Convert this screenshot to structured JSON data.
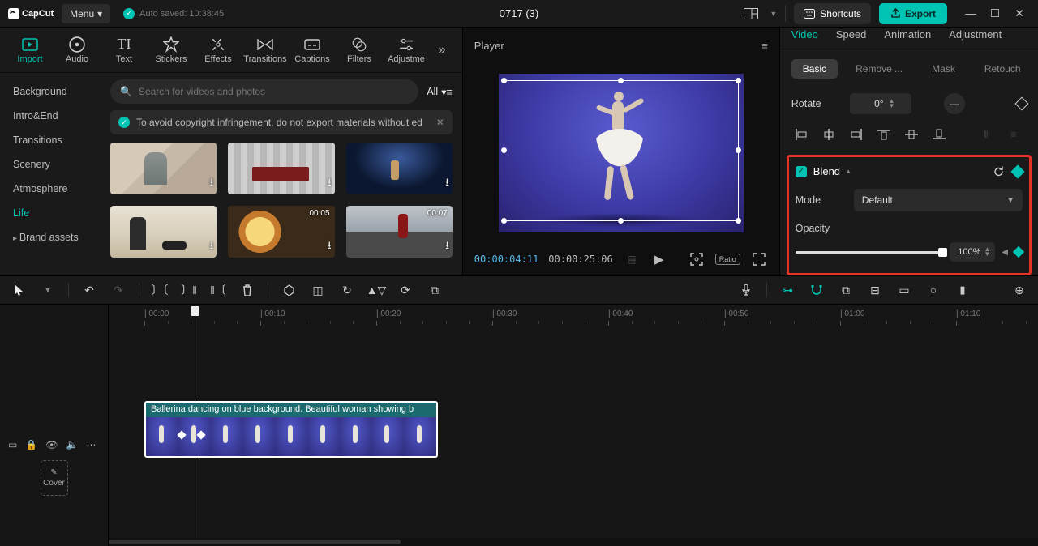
{
  "app": {
    "name": "CapCut",
    "menu": "Menu",
    "autosave": "Auto saved: 10:38:45",
    "project_title": "0717 (3)"
  },
  "topbar": {
    "shortcuts": "Shortcuts",
    "export": "Export"
  },
  "media_tabs": [
    "Import",
    "Audio",
    "Text",
    "Stickers",
    "Effects",
    "Transitions",
    "Captions",
    "Filters",
    "Adjustme"
  ],
  "media_tabs_icons": [
    "import-icon",
    "audio-icon",
    "text-icon",
    "stickers-icon",
    "effects-icon",
    "transitions-icon",
    "captions-icon",
    "filters-icon",
    "adjustment-icon"
  ],
  "side_categories": [
    "Background",
    "Intro&End",
    "Transitions",
    "Scenery",
    "Atmosphere",
    "Life",
    "Brand assets"
  ],
  "active_category": "Life",
  "search": {
    "placeholder": "Search for videos and photos",
    "all": "All"
  },
  "warning": "To avoid copyright infringement, do not export materials without ed",
  "thumb_durations": [
    "",
    "",
    "",
    "",
    "00:05",
    "00:07"
  ],
  "player": {
    "label": "Player",
    "current": "00:00:04:11",
    "duration": "00:00:25:06",
    "ratio": "Ratio"
  },
  "right_tabs": [
    "Video",
    "Speed",
    "Animation",
    "Adjustment"
  ],
  "sub_tabs": [
    "Basic",
    "Remove ...",
    "Mask",
    "Retouch"
  ],
  "rotate": {
    "label": "Rotate",
    "value": "0°"
  },
  "blend": {
    "title": "Blend",
    "mode_label": "Mode",
    "mode_value": "Default",
    "opacity_label": "Opacity",
    "opacity_value": "100%"
  },
  "timeline": {
    "marks": [
      "00:00",
      "00:10",
      "00:20",
      "00:30",
      "00:40",
      "00:50",
      "01:00",
      "01:10"
    ],
    "cover": "Cover",
    "clip_label": "Ballerina dancing on blue background. Beautiful woman showing b"
  }
}
